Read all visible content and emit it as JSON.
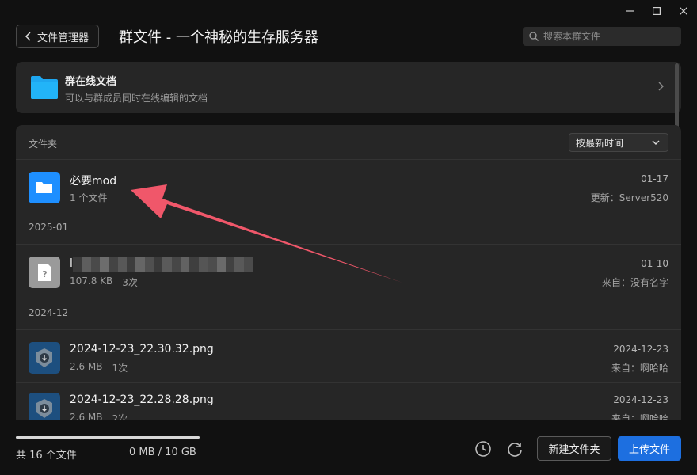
{
  "window": {
    "minimize_icon": "minimize-icon",
    "maximize_icon": "maximize-icon",
    "close_icon": "close-icon"
  },
  "header": {
    "back_label": "文件管理器",
    "title": "群文件 - 一个神秘的生存服务器",
    "search_placeholder": "搜索本群文件"
  },
  "online_docs": {
    "title": "群在线文档",
    "subtitle": "可以与群成员同时在线编辑的文档"
  },
  "file_panel": {
    "section_label": "文件夹",
    "sort_label": "按最新时间",
    "folder": {
      "name": "必要mod",
      "count": "1 个文件",
      "date": "01-17",
      "updated_by": "更新：Server520"
    },
    "groups": [
      {
        "label": "2025-01",
        "files": [
          {
            "name": "l",
            "size": "107.8 KB",
            "downloads": "3次",
            "date": "01-10",
            "uploader": "来自：没有名字"
          }
        ]
      },
      {
        "label": "2024-12",
        "files": [
          {
            "name": "2024-12-23_22.30.32.png",
            "size": "2.6 MB",
            "downloads": "1次",
            "date": "2024-12-23",
            "uploader": "来自：啊哈哈"
          },
          {
            "name": "2024-12-23_22.28.28.png",
            "size": "2.6 MB",
            "downloads": "2次",
            "date": "2024-12-23",
            "uploader": "来自：啊哈哈"
          }
        ]
      }
    ]
  },
  "footer": {
    "file_count": "共 16 个文件",
    "storage": "0 MB / 10 GB",
    "storage_used_fraction": 0.0,
    "new_folder_label": "新建文件夹",
    "upload_label": "上传文件"
  },
  "colors": {
    "accent": "#1d6fe0",
    "folder": "#1e90ff",
    "annotation_arrow": "#f0576a"
  }
}
